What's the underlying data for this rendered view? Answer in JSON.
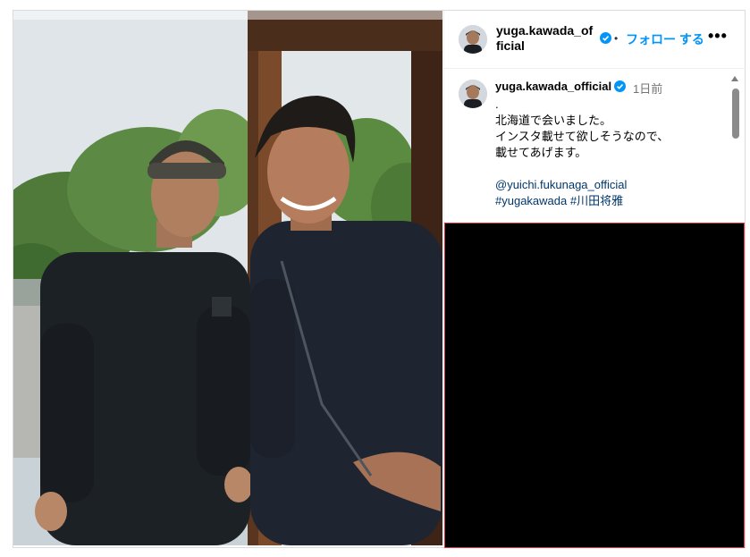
{
  "header": {
    "username": "yuga.kawada_official",
    "separator": "•",
    "follow_label": "フォロー する",
    "more_label": "•••",
    "verified_color": "#0095f6"
  },
  "comment": {
    "username": "yuga.kawada_official",
    "time": "1日前",
    "lines": [
      ".",
      "北海道で会いました。",
      "インスタ載せて欲しそうなので、",
      "載せてあげます。",
      "",
      "@yuichi.fukunaga_official",
      "#yugakawada #川田将雅"
    ],
    "mention": "@yuichi.fukunaga_official",
    "hashtags": [
      "#yugakawada",
      "#川田将雅"
    ]
  },
  "colors": {
    "accent": "#0095f6",
    "link": "#00376b",
    "media_border": "#e0313d"
  }
}
